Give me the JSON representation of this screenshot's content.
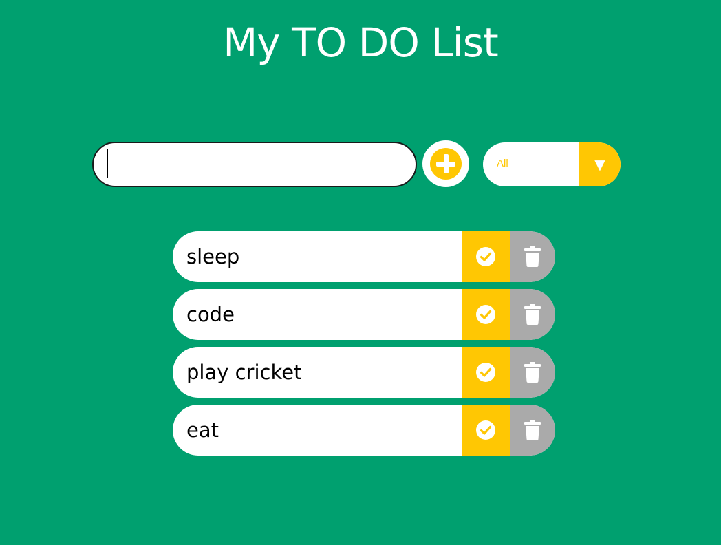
{
  "header": {
    "title": "My TO DO List"
  },
  "form": {
    "input_value": "",
    "input_placeholder": "",
    "add_icon": "plus-circle-icon",
    "filter": {
      "selected": "All",
      "arrow_icon": "caret-down-icon"
    }
  },
  "todos": [
    {
      "label": "sleep"
    },
    {
      "label": "code"
    },
    {
      "label": "play cricket"
    },
    {
      "label": "eat"
    }
  ],
  "icons": {
    "complete": "check-circle-icon",
    "delete": "trash-icon"
  },
  "colors": {
    "background": "#00a06f",
    "accent": "#ffc703",
    "trash": "#aaaaaa",
    "text": "#000000",
    "white": "#ffffff"
  }
}
